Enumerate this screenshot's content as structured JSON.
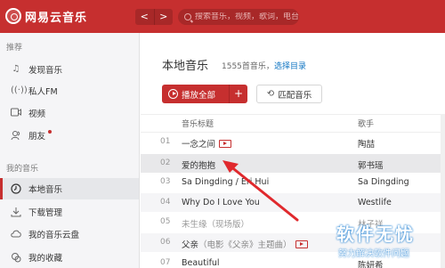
{
  "app": {
    "title": "网易云音乐"
  },
  "nav": {
    "back": "<",
    "forward": ">"
  },
  "search": {
    "placeholder": "搜索音乐，视频，歌词，电台"
  },
  "sidebar": {
    "recommend_title": "推荐",
    "recommend_items": [
      {
        "label": "发现音乐",
        "icon": "music-note-icon"
      },
      {
        "label": "私人FM",
        "icon": "radio-icon"
      },
      {
        "label": "视频",
        "icon": "video-icon"
      },
      {
        "label": "朋友",
        "icon": "friends-icon"
      }
    ],
    "my_music_title": "我的音乐",
    "my_music_items": [
      {
        "label": "本地音乐",
        "icon": "clock-icon",
        "active": true
      },
      {
        "label": "下载管理",
        "icon": "download-icon"
      },
      {
        "label": "我的音乐云盘",
        "icon": "cloud-icon"
      },
      {
        "label": "我的收藏",
        "icon": "collection-icon"
      }
    ]
  },
  "main": {
    "title": "本地音乐",
    "count": "1555首音乐，",
    "select_dir": "选择目录",
    "play_all": "播放全部",
    "play_add": "+",
    "match": "匹配音乐",
    "columns": {
      "title": "音乐标题",
      "artist": "歌手"
    },
    "rows": [
      {
        "num": "01",
        "title": "一念之间",
        "sub": "",
        "artist": "陶喆",
        "mv": true,
        "gray": false
      },
      {
        "num": "02",
        "title": "爱的抱抱",
        "sub": "",
        "artist": "郭书瑶",
        "mv": false,
        "gray": false
      },
      {
        "num": "03",
        "title": "Sa Dingding / Eri Hui",
        "sub": "",
        "artist": "Sa Dingding",
        "mv": false,
        "gray": false
      },
      {
        "num": "04",
        "title": "Why Do I Love You",
        "sub": "",
        "artist": "Westlife",
        "mv": false,
        "gray": false
      },
      {
        "num": "05",
        "title": "未生缘",
        "sub": "（现场版）",
        "artist": "林子祥",
        "mv": false,
        "gray": true
      },
      {
        "num": "06",
        "title": "父亲",
        "sub": "（电影《父亲》主题曲）",
        "artist": "",
        "mv": true,
        "gray": false
      },
      {
        "num": "07",
        "title": "Beautiful",
        "sub": "",
        "artist": "陈妍希",
        "mv": false,
        "gray": false
      }
    ]
  },
  "watermark": {
    "main": "软件无忧",
    "sub": "努力解决软件问题"
  },
  "colors": {
    "brand": "#c62f2f",
    "link": "#0c73c2"
  }
}
